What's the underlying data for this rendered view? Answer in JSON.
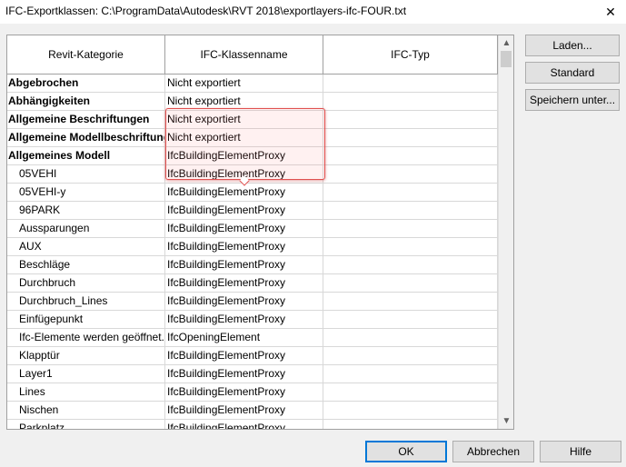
{
  "window": {
    "title": "IFC-Exportklassen: C:\\ProgramData\\Autodesk\\RVT 2018\\exportlayers-ifc-FOUR.txt",
    "close_glyph": "✕"
  },
  "table": {
    "columns": [
      "Revit-Kategorie",
      "IFC-Klassenname",
      "IFC-Typ"
    ],
    "rows": [
      {
        "category": "Abgebrochen",
        "ifc_class": "Nicht exportiert",
        "ifc_type": ""
      },
      {
        "category": "Abhängigkeiten",
        "ifc_class": "Nicht exportiert",
        "ifc_type": ""
      },
      {
        "category": "Allgemeine Beschriftungen",
        "ifc_class": "Nicht exportiert",
        "ifc_type": ""
      },
      {
        "category": "Allgemeine Modellbeschriftungen",
        "ifc_class": "Nicht exportiert",
        "ifc_type": ""
      },
      {
        "category": "Allgemeines Modell",
        "ifc_class": "IfcBuildingElementProxy",
        "ifc_type": ""
      },
      {
        "category": "05VEHI",
        "ifc_class": "IfcBuildingElementProxy",
        "ifc_type": ""
      },
      {
        "category": "05VEHI-y",
        "ifc_class": "IfcBuildingElementProxy",
        "ifc_type": ""
      },
      {
        "category": "96PARK",
        "ifc_class": "IfcBuildingElementProxy",
        "ifc_type": ""
      },
      {
        "category": "Aussparungen",
        "ifc_class": "IfcBuildingElementProxy",
        "ifc_type": ""
      },
      {
        "category": "AUX",
        "ifc_class": "IfcBuildingElementProxy",
        "ifc_type": ""
      },
      {
        "category": "Beschläge",
        "ifc_class": "IfcBuildingElementProxy",
        "ifc_type": ""
      },
      {
        "category": "Durchbruch",
        "ifc_class": "IfcBuildingElementProxy",
        "ifc_type": ""
      },
      {
        "category": "Durchbruch_Lines",
        "ifc_class": "IfcBuildingElementProxy",
        "ifc_type": ""
      },
      {
        "category": "Einfügepunkt",
        "ifc_class": "IfcBuildingElementProxy",
        "ifc_type": ""
      },
      {
        "category": "Ifc-Elemente werden geöffnet.",
        "ifc_class": "IfcOpeningElement",
        "ifc_type": ""
      },
      {
        "category": "Klapptür",
        "ifc_class": "IfcBuildingElementProxy",
        "ifc_type": ""
      },
      {
        "category": "Layer1",
        "ifc_class": "IfcBuildingElementProxy",
        "ifc_type": ""
      },
      {
        "category": "Lines",
        "ifc_class": "IfcBuildingElementProxy",
        "ifc_type": ""
      },
      {
        "category": "Nischen",
        "ifc_class": "IfcBuildingElementProxy",
        "ifc_type": ""
      },
      {
        "category": "Parkplatz",
        "ifc_class": "IfcBuildingElementProxy",
        "ifc_type": ""
      }
    ],
    "scroll_up_glyph": "▲",
    "scroll_down_glyph": "▼"
  },
  "side_buttons": {
    "load": "Laden...",
    "standard": "Standard",
    "save_as": "Speichern unter..."
  },
  "bottom_buttons": {
    "ok": "OK",
    "cancel": "Abbrechen",
    "help": "Hilfe"
  }
}
